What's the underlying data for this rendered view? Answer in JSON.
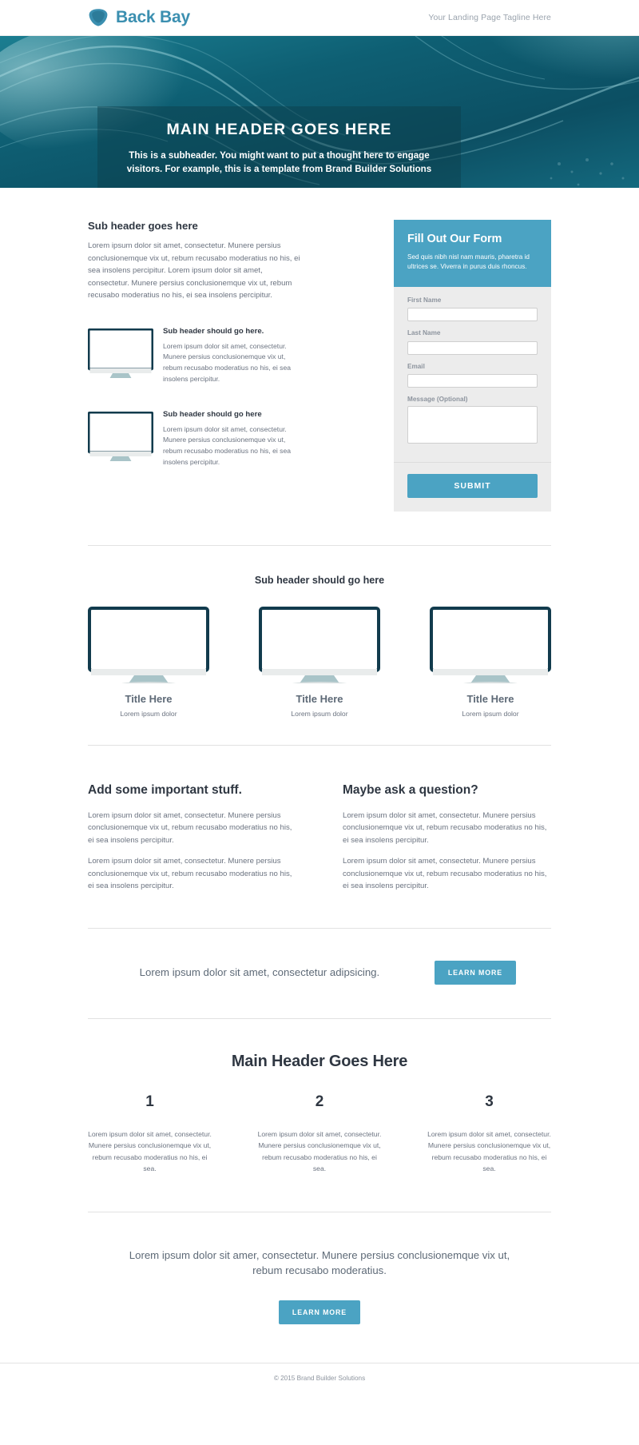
{
  "nav": {
    "brand_name": "Back Bay",
    "logo_icon": "gem-icon",
    "tagline": "Your Landing Page Tagline Here",
    "brand_color": "#3b8fb0"
  },
  "hero": {
    "title": "MAIN HEADER GOES HERE",
    "subtitle": "This is a subheader. You might want to put a thought here to engage visitors. For example, this is a template from Brand Builder Solutions",
    "bg_color": "#0d5b6e"
  },
  "intro": {
    "heading": "Sub header goes here",
    "paragraph": "Lorem ipsum dolor sit amet, consectetur. Munere persius conclusionemque vix ut, rebum recusabo moderatius no his, ei sea insolens percipitur. Lorem ipsum dolor sit amet, consectetur. Munere persius conclusionemque vix ut, rebum recusabo moderatius no his, ei sea insolens percipitur."
  },
  "features": [
    {
      "icon": "monitor-icon",
      "title": "Sub header should go here.",
      "text": "Lorem ipsum dolor sit amet, consectetur. Munere persius conclusionemque vix ut, rebum recusabo moderatius no his, ei sea insolens percipitur."
    },
    {
      "icon": "monitor-icon",
      "title": "Sub header should go here",
      "text": "Lorem ipsum dolor sit amet, consectetur. Munere persius conclusionemque vix ut, rebum recusabo moderatius no his, ei sea insolens percipitur."
    }
  ],
  "form": {
    "title": "Fill Out Our Form",
    "subtitle": "Sed quis nibh nisl nam mauris, pharetra id ultrices se. Viverra in purus duis rhoncus.",
    "header_color": "#4ba3c3",
    "fields": [
      {
        "label": "First Name",
        "value": "",
        "placeholder": "",
        "type": "text"
      },
      {
        "label": "Last Name",
        "value": "",
        "placeholder": "",
        "type": "text"
      },
      {
        "label": "Email",
        "value": "",
        "placeholder": "",
        "type": "text"
      },
      {
        "label": "Message (Optional)",
        "value": "",
        "placeholder": "",
        "type": "textarea"
      }
    ],
    "submit_label": "SUBMIT"
  },
  "showcase": {
    "heading": "Sub header should go here",
    "cards": [
      {
        "icon": "monitor-icon",
        "title": "Title Here",
        "subtitle": "Lorem ipsum dolor"
      },
      {
        "icon": "monitor-icon",
        "title": "Title Here",
        "subtitle": "Lorem ipsum dolor"
      },
      {
        "icon": "monitor-icon",
        "title": "Title Here",
        "subtitle": "Lorem ipsum dolor"
      }
    ]
  },
  "textcols": [
    {
      "heading": "Add some important stuff.",
      "p1": "Lorem ipsum dolor sit amet, consectetur. Munere persius conclusionemque vix ut, rebum recusabo moderatius no his, ei sea insolens percipitur.",
      "p2": "Lorem ipsum dolor sit amet, consectetur. Munere persius conclusionemque vix ut, rebum recusabo moderatius no his, ei sea insolens percipitur."
    },
    {
      "heading": "Maybe ask a question?",
      "p1": "Lorem ipsum dolor sit amet, consectetur. Munere persius conclusionemque vix ut, rebum recusabo moderatius no his, ei sea insolens percipitur.",
      "p2": "Lorem ipsum dolor sit amet, consectetur. Munere persius conclusionemque vix ut, rebum recusabo moderatius no his, ei sea insolens percipitur."
    }
  ],
  "cta": {
    "text": "Lorem ipsum dolor sit amet, consectetur adipsicing.",
    "button_label": "LEARN MORE"
  },
  "numbers": {
    "heading": "Main Header Goes Here",
    "items": [
      {
        "number": "1",
        "text": "Lorem ipsum dolor sit amet, consectetur. Munere persius conclusionemque vix ut, rebum recusabo moderatius no his, ei sea."
      },
      {
        "number": "2",
        "text": "Lorem ipsum dolor sit amet, consectetur. Munere persius conclusionemque vix ut, rebum recusabo moderatius no his, ei sea."
      },
      {
        "number": "3",
        "text": "Lorem ipsum dolor sit amet, consectetur. Munere persius conclusionemque vix ut, rebum recusabo moderatius no his, ei sea."
      }
    ]
  },
  "closer": {
    "text": "Lorem ipsum dolor sit amer, consectetur. Munere persius conclusionemque vix ut, rebum recusabo moderatius.",
    "button_label": "LEARN MORE"
  },
  "footer": {
    "copyright": "© 2015 Brand Builder Solutions"
  }
}
